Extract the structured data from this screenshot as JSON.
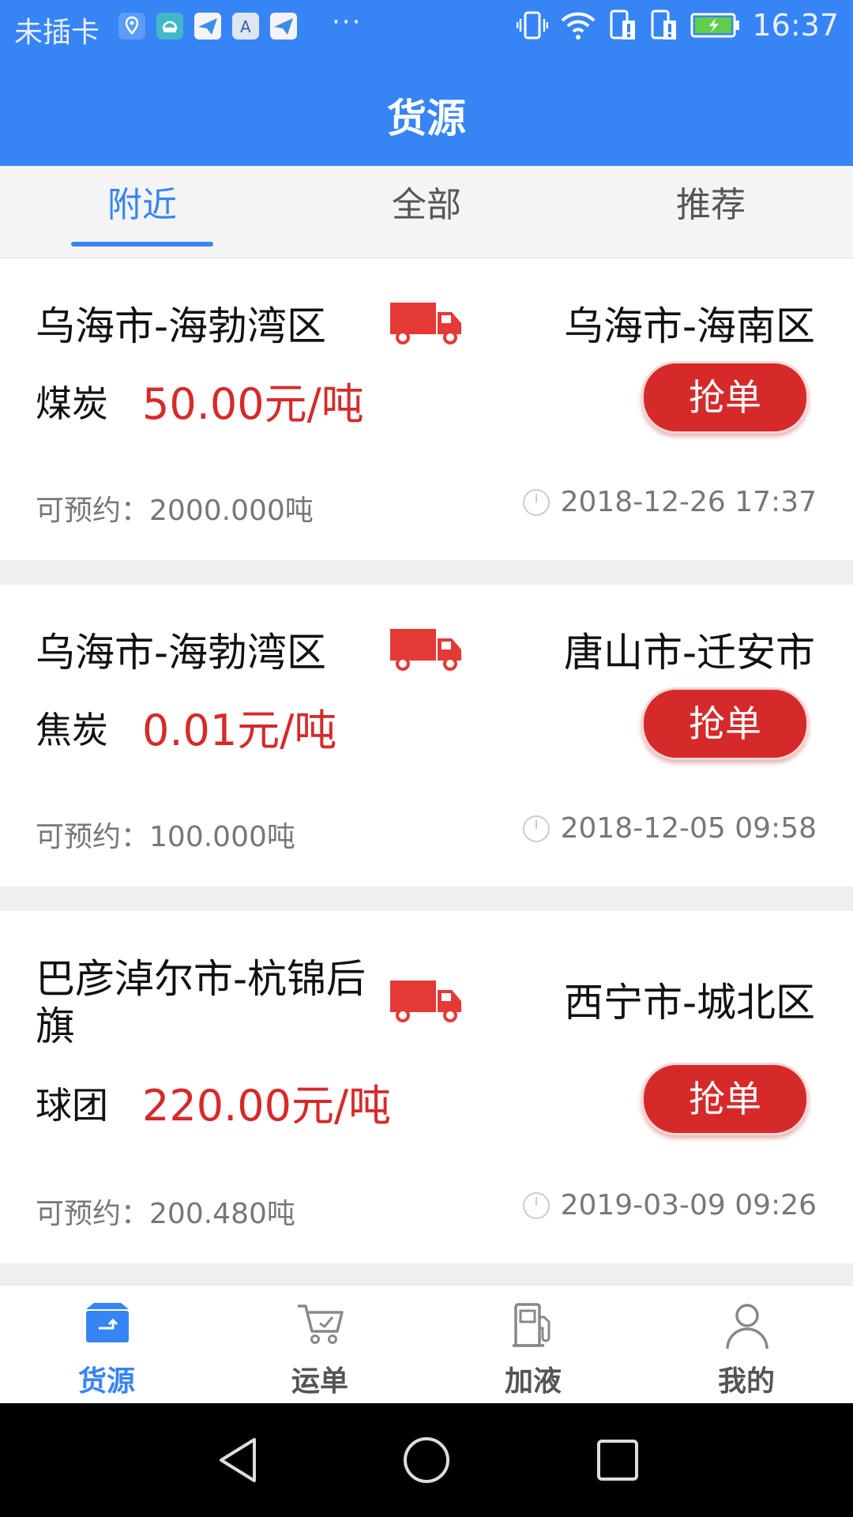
{
  "status_bar": {
    "carrier": "未插卡",
    "dots": "···",
    "time": "16:37"
  },
  "header": {
    "title": "货源"
  },
  "tabs": [
    {
      "label": "附近",
      "active": true
    },
    {
      "label": "全部",
      "active": false
    },
    {
      "label": "推荐",
      "active": false
    }
  ],
  "listings": [
    {
      "from": "乌海市-海勃湾区",
      "to": "乌海市-海南区",
      "goods": "煤炭",
      "price": "50.00元/吨",
      "grab_label": "抢单",
      "avail_label": "可预约：",
      "avail_value": "2000.000吨",
      "datetime": "2018-12-26 17:37"
    },
    {
      "from": "乌海市-海勃湾区",
      "to": "唐山市-迁安市",
      "goods": "焦炭",
      "price": "0.01元/吨",
      "grab_label": "抢单",
      "avail_label": "可预约：",
      "avail_value": "100.000吨",
      "datetime": "2018-12-05 09:58"
    },
    {
      "from": "巴彦淖尔市-杭锦后旗",
      "to": "西宁市-城北区",
      "goods": "球团",
      "price": "220.00元/吨",
      "grab_label": "抢单",
      "avail_label": "可预约：",
      "avail_value": "200.480吨",
      "datetime": "2019-03-09 09:26"
    }
  ],
  "bottom_nav": [
    {
      "label": "货源",
      "icon": "box-icon",
      "active": true
    },
    {
      "label": "运单",
      "icon": "cart-icon",
      "active": false
    },
    {
      "label": "加液",
      "icon": "fuel-pump-icon",
      "active": false
    },
    {
      "label": "我的",
      "icon": "person-icon",
      "active": false
    }
  ],
  "colors": {
    "primary": "#3784f4",
    "accent_red": "#d62a2a"
  }
}
